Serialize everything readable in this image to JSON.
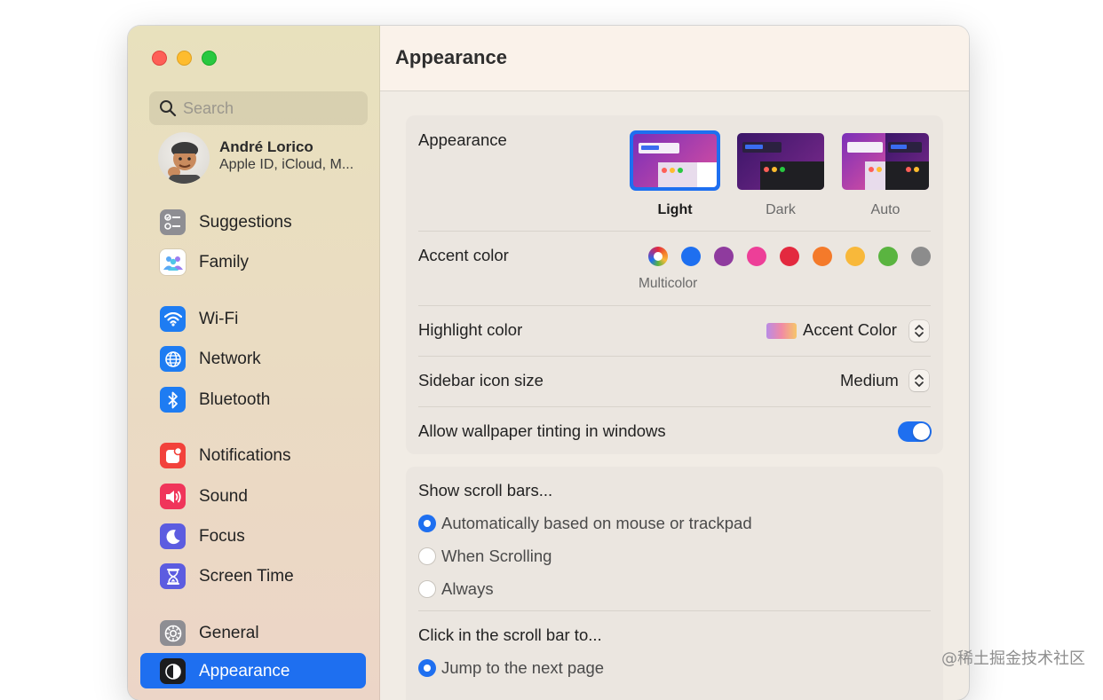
{
  "window": {
    "title": "Appearance"
  },
  "sidebar": {
    "search": {
      "placeholder": "Search"
    },
    "account": {
      "name": "André Lorico",
      "subtitle": "Apple ID, iCloud, M..."
    },
    "items": [
      {
        "label": "Suggestions",
        "icon": "suggestions-icon",
        "color": "#8e8e93"
      },
      {
        "label": "Family",
        "icon": "family-icon",
        "color": "#ffffff"
      },
      {
        "label": "Wi-Fi",
        "icon": "wifi-icon",
        "color": "#1e7cf2"
      },
      {
        "label": "Network",
        "icon": "globe-icon",
        "color": "#1e7cf2"
      },
      {
        "label": "Bluetooth",
        "icon": "bluetooth-icon",
        "color": "#1e7cf2"
      },
      {
        "label": "Notifications",
        "icon": "bell-icon",
        "color": "#f2423b"
      },
      {
        "label": "Sound",
        "icon": "speaker-icon",
        "color": "#f0355a"
      },
      {
        "label": "Focus",
        "icon": "moon-icon",
        "color": "#5c5ce0"
      },
      {
        "label": "Screen Time",
        "icon": "hourglass-icon",
        "color": "#5c5ce0"
      },
      {
        "label": "General",
        "icon": "gear-icon",
        "color": "#8e8e93"
      },
      {
        "label": "Appearance",
        "icon": "appearance-icon",
        "color": "#1c1c1e",
        "selected": true
      }
    ]
  },
  "appearance_group": {
    "label": "Appearance",
    "options": [
      {
        "label": "Light",
        "selected": true
      },
      {
        "label": "Dark",
        "selected": false
      },
      {
        "label": "Auto",
        "selected": false
      }
    ],
    "accent_label": "Accent color",
    "accent_colors": [
      {
        "name": "multicolor",
        "color": "conic",
        "selected": true
      },
      {
        "name": "blue",
        "color": "#1e6ff0"
      },
      {
        "name": "purple",
        "color": "#8f3b9e"
      },
      {
        "name": "pink",
        "color": "#ed3f98"
      },
      {
        "name": "red",
        "color": "#e3293f"
      },
      {
        "name": "orange",
        "color": "#f47a2a"
      },
      {
        "name": "yellow",
        "color": "#f8b83a"
      },
      {
        "name": "green",
        "color": "#5ab440"
      },
      {
        "name": "graphite",
        "color": "#8c8c8c"
      }
    ],
    "accent_selected_caption": "Multicolor",
    "highlight_label": "Highlight color",
    "highlight_value": "Accent Color",
    "sidebar_icon_label": "Sidebar icon size",
    "sidebar_icon_value": "Medium",
    "tinting_label": "Allow wallpaper tinting in windows",
    "tinting_on": true
  },
  "scroll_group": {
    "show_label": "Show scroll bars...",
    "show_options": [
      {
        "label": "Automatically based on mouse or trackpad",
        "selected": true
      },
      {
        "label": "When Scrolling",
        "selected": false
      },
      {
        "label": "Always",
        "selected": false
      }
    ],
    "click_label": "Click in the scroll bar to...",
    "click_options": [
      {
        "label": "Jump to the next page",
        "selected": true
      }
    ]
  },
  "watermark": "@稀土掘金技术社区"
}
